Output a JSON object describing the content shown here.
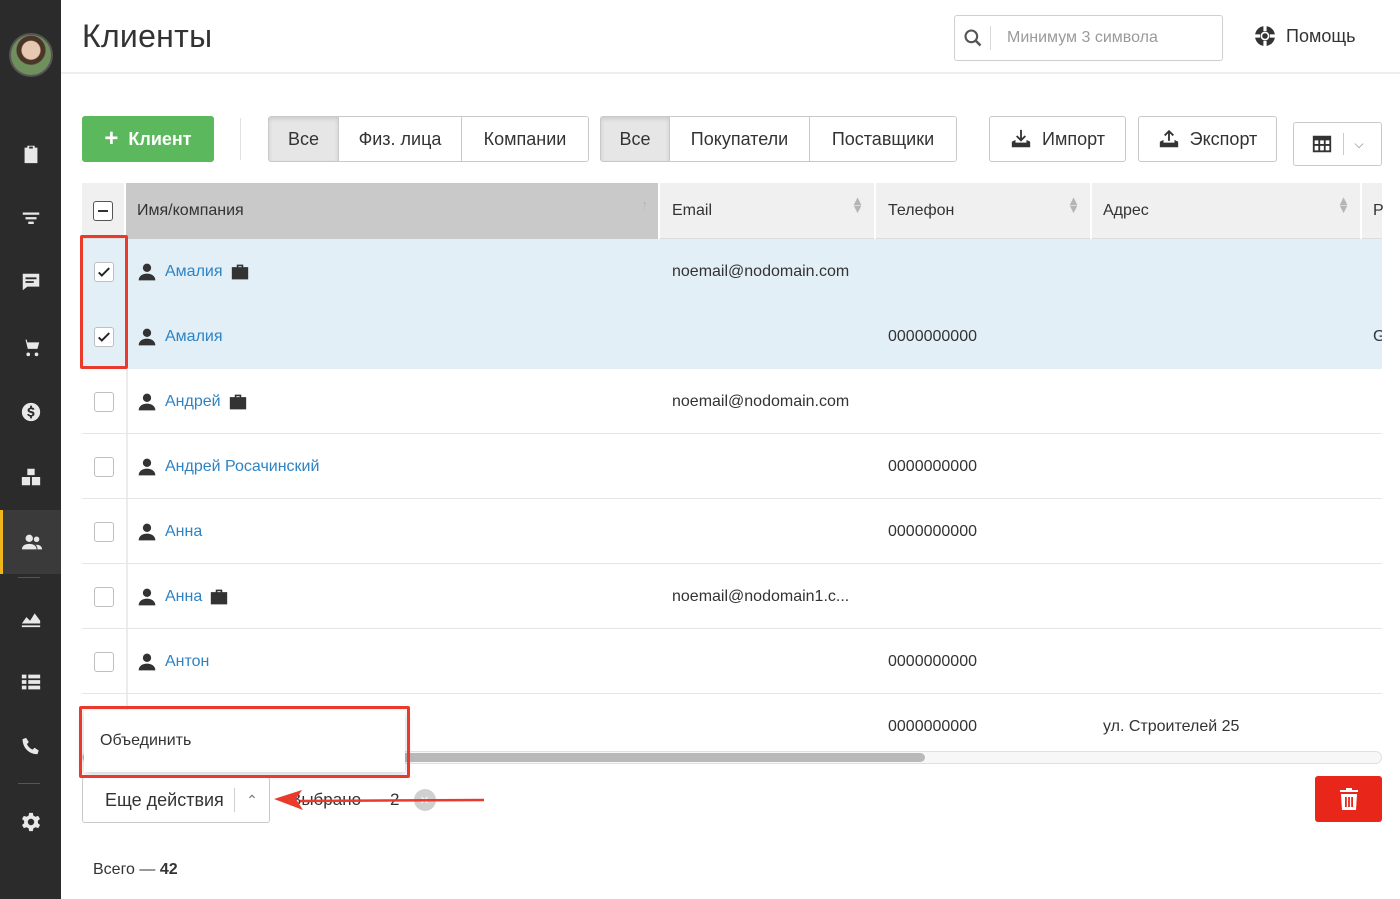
{
  "sidebar": {
    "items": [
      {
        "icon": "clipboard-check-icon"
      },
      {
        "icon": "funnel-icon"
      },
      {
        "icon": "message-icon"
      },
      {
        "icon": "cart-icon"
      },
      {
        "icon": "dollar-icon"
      },
      {
        "icon": "boxes-icon"
      },
      {
        "icon": "users-icon",
        "active": true
      },
      {
        "icon": "chart-area-icon"
      },
      {
        "icon": "table-list-icon"
      },
      {
        "icon": "phone-icon"
      },
      {
        "icon": "gear-icon"
      }
    ]
  },
  "header": {
    "title": "Клиенты",
    "search_placeholder": "Минимум 3 символа",
    "help_label": "Помощь"
  },
  "toolbar": {
    "add_label": "Клиент",
    "type_filter": [
      "Все",
      "Физ. лица",
      "Компании"
    ],
    "role_filter": [
      "Все",
      "Покупатели",
      "Поставщики"
    ],
    "import_label": "Импорт",
    "export_label": "Экспорт"
  },
  "table": {
    "columns": {
      "name": "Имя/компания",
      "email": "Email",
      "phone": "Телефон",
      "address": "Адрес",
      "extra": "Р"
    },
    "rows": [
      {
        "name": "Амалия",
        "company": true,
        "email": "noemail@nodomain.com",
        "phone": "",
        "address": "",
        "extra": "",
        "checked": true
      },
      {
        "name": "Амалия",
        "company": false,
        "email": "",
        "phone": "0000000000",
        "address": "",
        "extra": "G",
        "checked": true
      },
      {
        "name": "Андрей",
        "company": true,
        "email": "noemail@nodomain.com",
        "phone": "",
        "address": "",
        "extra": "",
        "checked": false
      },
      {
        "name": "Андрей Росачинский",
        "company": false,
        "email": "",
        "phone": "0000000000",
        "address": "",
        "extra": "",
        "checked": false
      },
      {
        "name": "Анна",
        "company": false,
        "email": "",
        "phone": "0000000000",
        "address": "",
        "extra": "",
        "checked": false
      },
      {
        "name": "Анна",
        "company": true,
        "email": "noemail@nodomain1.c...",
        "phone": "",
        "address": "",
        "extra": "",
        "checked": false
      },
      {
        "name": "Антон",
        "company": false,
        "email": "",
        "phone": "0000000000",
        "address": "",
        "extra": "",
        "checked": false
      },
      {
        "name": "",
        "company": false,
        "email": "",
        "phone": "0000000000",
        "address": "ул. Строителей 25",
        "extra": "",
        "checked": false
      }
    ]
  },
  "actions": {
    "menu_item": "Объединить",
    "more_label": "Еще действия",
    "selected_label": "Выбрано",
    "selected_count": "2",
    "total_prefix": "Всего —",
    "total_value": "42"
  },
  "colors": {
    "accent_green": "#5cb85c",
    "link_blue": "#2e83c4",
    "danger_red": "#e8261a",
    "annotation_red": "#ea3a2b",
    "sidebar_bg": "#2b2b2b",
    "selected_row": "#e3eff7"
  }
}
